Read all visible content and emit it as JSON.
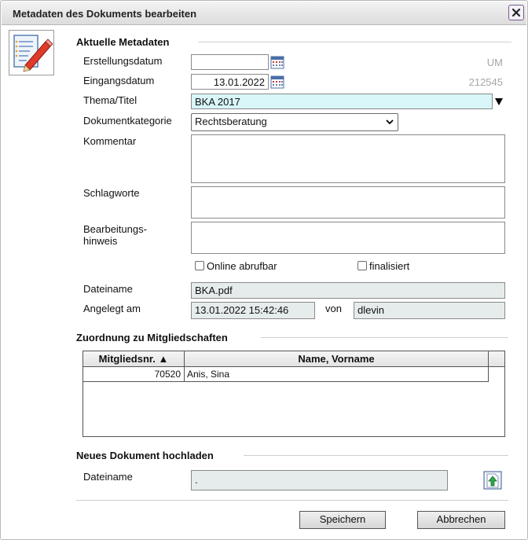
{
  "dialog": {
    "title": "Metadaten des Dokuments bearbeiten",
    "close_icon": "close-icon"
  },
  "sections": {
    "current_metadata": "Aktuelle Metadaten",
    "membership": "Zuordnung zu Mitgliedschaften",
    "upload": "Neues Dokument hochladen"
  },
  "fields": {
    "erstellungsdatum": {
      "label": "Erstellungsdatum",
      "value": "",
      "note": "UM"
    },
    "eingangsdatum": {
      "label": "Eingangsdatum",
      "value": "13.01.2022",
      "note": "212545"
    },
    "thema": {
      "label": "Thema/Titel",
      "value": "BKA 2017"
    },
    "kategorie": {
      "label": "Dokumentkategorie",
      "value": "Rechtsberatung"
    },
    "kommentar": {
      "label": "Kommentar",
      "value": ""
    },
    "schlagworte": {
      "label": "Schlagworte",
      "value": ""
    },
    "hinweis": {
      "label_line1": "Bearbeitungs-",
      "label_line2": "hinweis",
      "value": ""
    },
    "online": {
      "label": "Online abrufbar",
      "checked": false
    },
    "finalisiert": {
      "label": "finalisiert",
      "checked": false
    },
    "dateiname": {
      "label": "Dateiname",
      "value": "BKA.pdf"
    },
    "angelegt": {
      "label": "Angelegt am",
      "value": "13.01.2022 15:42:46",
      "von_label": "von",
      "user": "dlevin"
    }
  },
  "table": {
    "columns": [
      "Mitgliedsnr. ▲",
      "Name, Vorname"
    ],
    "rows": [
      {
        "nr": "70520",
        "name": "Anis, Sina"
      }
    ]
  },
  "upload": {
    "label": "Dateiname",
    "value": "."
  },
  "buttons": {
    "save": "Speichern",
    "cancel": "Abbrechen"
  },
  "colors": {
    "accent_cyan": "#d9f6f8",
    "readonly": "#e6ecec",
    "note_grey": "#a6a6a6"
  }
}
